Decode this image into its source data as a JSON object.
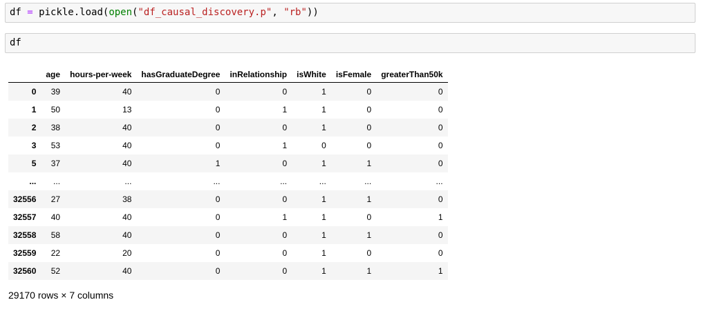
{
  "cells": [
    {
      "name": "code-cell-load",
      "tokens": [
        {
          "text": "df ",
          "color": "default"
        },
        {
          "text": "=",
          "color": "operator"
        },
        {
          "text": " pickle.load(",
          "color": "default"
        },
        {
          "text": "open",
          "color": "builtin"
        },
        {
          "text": "(",
          "color": "default"
        },
        {
          "text": "\"df_causal_discovery.p\"",
          "color": "string"
        },
        {
          "text": ", ",
          "color": "default"
        },
        {
          "text": "\"rb\"",
          "color": "string"
        },
        {
          "text": "))",
          "color": "default"
        }
      ]
    },
    {
      "name": "code-cell-df",
      "tokens": [
        {
          "text": "df",
          "color": "default"
        }
      ]
    }
  ],
  "table": {
    "index_header": "",
    "columns": [
      "age",
      "hours-per-week",
      "hasGraduateDegree",
      "inRelationship",
      "isWhite",
      "isFemale",
      "greaterThan50k"
    ],
    "rows": [
      {
        "index": "0",
        "values": [
          "39",
          "40",
          "0",
          "0",
          "1",
          "0",
          "0"
        ]
      },
      {
        "index": "1",
        "values": [
          "50",
          "13",
          "0",
          "1",
          "1",
          "0",
          "0"
        ]
      },
      {
        "index": "2",
        "values": [
          "38",
          "40",
          "0",
          "0",
          "1",
          "0",
          "0"
        ]
      },
      {
        "index": "3",
        "values": [
          "53",
          "40",
          "0",
          "1",
          "0",
          "0",
          "0"
        ]
      },
      {
        "index": "5",
        "values": [
          "37",
          "40",
          "1",
          "0",
          "1",
          "1",
          "0"
        ]
      },
      {
        "index": "...",
        "values": [
          "...",
          "...",
          "...",
          "...",
          "...",
          "...",
          "..."
        ]
      },
      {
        "index": "32556",
        "values": [
          "27",
          "38",
          "0",
          "0",
          "1",
          "1",
          "0"
        ]
      },
      {
        "index": "32557",
        "values": [
          "40",
          "40",
          "0",
          "1",
          "1",
          "0",
          "1"
        ]
      },
      {
        "index": "32558",
        "values": [
          "58",
          "40",
          "0",
          "0",
          "1",
          "1",
          "0"
        ]
      },
      {
        "index": "32559",
        "values": [
          "22",
          "20",
          "0",
          "0",
          "1",
          "0",
          "0"
        ]
      },
      {
        "index": "32560",
        "values": [
          "52",
          "40",
          "0",
          "0",
          "1",
          "1",
          "1"
        ]
      }
    ],
    "summary": "29170 rows × 7 columns"
  },
  "colors": {
    "operator": "#AA22FF",
    "builtin": "#008000",
    "string": "#BA2121",
    "default": "#000000",
    "cell_background": "#f7f7f7",
    "cell_border": "#cfcfcf",
    "row_stripe": "#f5f5f5"
  }
}
